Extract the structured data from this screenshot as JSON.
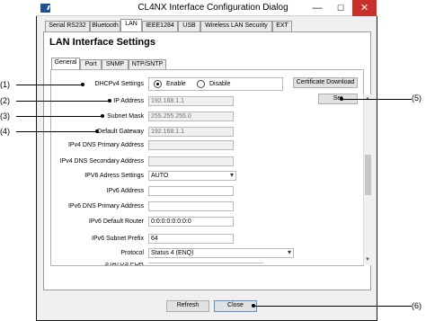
{
  "window": {
    "title": "CL4NX Interface Configuration Dialog"
  },
  "titlebar": {
    "minimize": "—",
    "maximize": "☐",
    "close": "✕"
  },
  "top_tabs": [
    "Serial RS232",
    "Bluetooth",
    "LAN",
    "IEEE1284",
    "USB",
    "Wireless LAN Security",
    "EXT"
  ],
  "heading": "LAN Interface Settings",
  "sub_tabs": [
    "General",
    "Port",
    "SNMP",
    "NTP/SNTP"
  ],
  "form": {
    "dhcp_label": "DHCPv4 Settings",
    "dhcp_options": [
      "Enable",
      "Disable"
    ],
    "ip_label": "IP Address",
    "ip_value": "192.168.1.1",
    "subnet_label": "Subnet Mask",
    "subnet_value": "255.255.255.0",
    "gateway_label": "Default Gateway",
    "gateway_value": "192.168.1.1",
    "dns_primary_label": "IPv4 DNS Primary Address",
    "dns_secondary_label": "IPv4 DNS Secondary Address",
    "ipv6_settings_label": "IPV6 Adress Settings",
    "ipv6_settings_value": "AUTO",
    "ipv6_address_label": "IPv6 Address",
    "ipv6_dns_label": "IPv6 DNS Primary Address",
    "ipv6_router_label": "IPv6 Default Router",
    "ipv6_router_value": "0:0:0:0:0:0:0:0",
    "ipv6_prefix_label": "IPv6 Subnet Prefix",
    "ipv6_prefix_value": "64",
    "protocol_label": "Protocol",
    "protocol_value": "Status 4 (ENQ)",
    "status_label": "STATUS POR"
  },
  "buttons": {
    "cert_download": "Certificate Download",
    "set": "Set",
    "refresh": "Refresh",
    "close": "Close"
  },
  "callouts": [
    "(1)",
    "(2)",
    "(3)",
    "(4)",
    "(5)",
    "(6)"
  ],
  "colors": {
    "accent_close": "#c9302c",
    "icon_blue": "#1d4f91"
  }
}
